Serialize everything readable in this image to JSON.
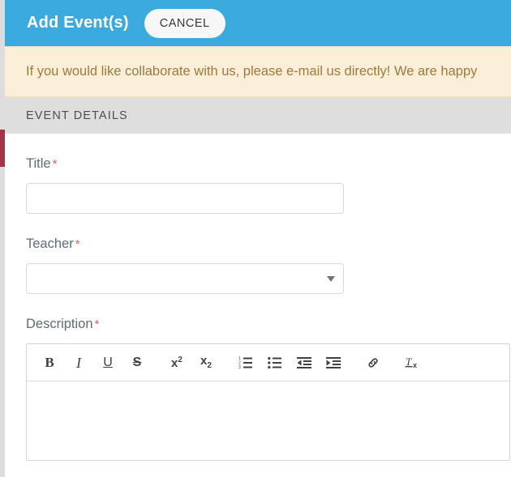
{
  "theme": {
    "header_blue": "#3BAADE",
    "alert_bg": "#fcefd9",
    "alert_text": "#9c7a3c",
    "section_bg": "#dedede",
    "required_star": "#ef5a6b",
    "backdrop_accent": "#a63446"
  },
  "header": {
    "title": "Add Event(s)",
    "cancel_label": "CANCEL"
  },
  "alert": {
    "message": "If you would like collaborate with us, please e-mail us directly! We are happy"
  },
  "section": {
    "label": "EVENT DETAILS"
  },
  "form": {
    "title_field": {
      "label": "Title",
      "required_mark": "*",
      "value": "",
      "placeholder": ""
    },
    "teacher_field": {
      "label": "Teacher",
      "required_mark": "*",
      "selected": "",
      "caret_icon": "chevron-down-icon"
    },
    "description_field": {
      "label": "Description",
      "required_mark": "*",
      "content": ""
    }
  },
  "editor_toolbar": {
    "buttons": [
      {
        "name": "bold",
        "glyph": "B"
      },
      {
        "name": "italic",
        "glyph": "I"
      },
      {
        "name": "underline",
        "glyph": "U"
      },
      {
        "name": "strikethrough",
        "glyph": "S"
      },
      {
        "name": "superscript",
        "glyph": "x",
        "script": "2"
      },
      {
        "name": "subscript",
        "glyph": "x",
        "script": "2"
      },
      {
        "name": "numbered-list",
        "glyph": ""
      },
      {
        "name": "bulleted-list",
        "glyph": ""
      },
      {
        "name": "outdent",
        "glyph": ""
      },
      {
        "name": "indent",
        "glyph": ""
      },
      {
        "name": "link",
        "glyph": ""
      },
      {
        "name": "remove-format",
        "glyph": ""
      }
    ]
  }
}
